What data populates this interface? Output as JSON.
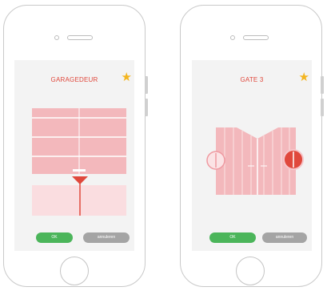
{
  "screens": [
    {
      "title": "GARAGEDEUR",
      "favorite_icon": "star-icon",
      "ok_label": "OK",
      "cancel_label": "annuleren",
      "door_type": "garage-door",
      "position_marker_icon": "triangle-down-icon"
    },
    {
      "title": "GATE 3",
      "favorite_icon": "star-icon",
      "ok_label": "OK",
      "cancel_label": "annuleren",
      "door_type": "double-gate",
      "handle_icon": "circle-handle-icon"
    }
  ],
  "colors": {
    "accent_red": "#e0483c",
    "door_pink": "#f3b8bc",
    "door_light": "#fadde0",
    "ok_green": "#4bb55a",
    "cancel_gray": "#a4a4a4",
    "star_yellow": "#f3b51f"
  }
}
